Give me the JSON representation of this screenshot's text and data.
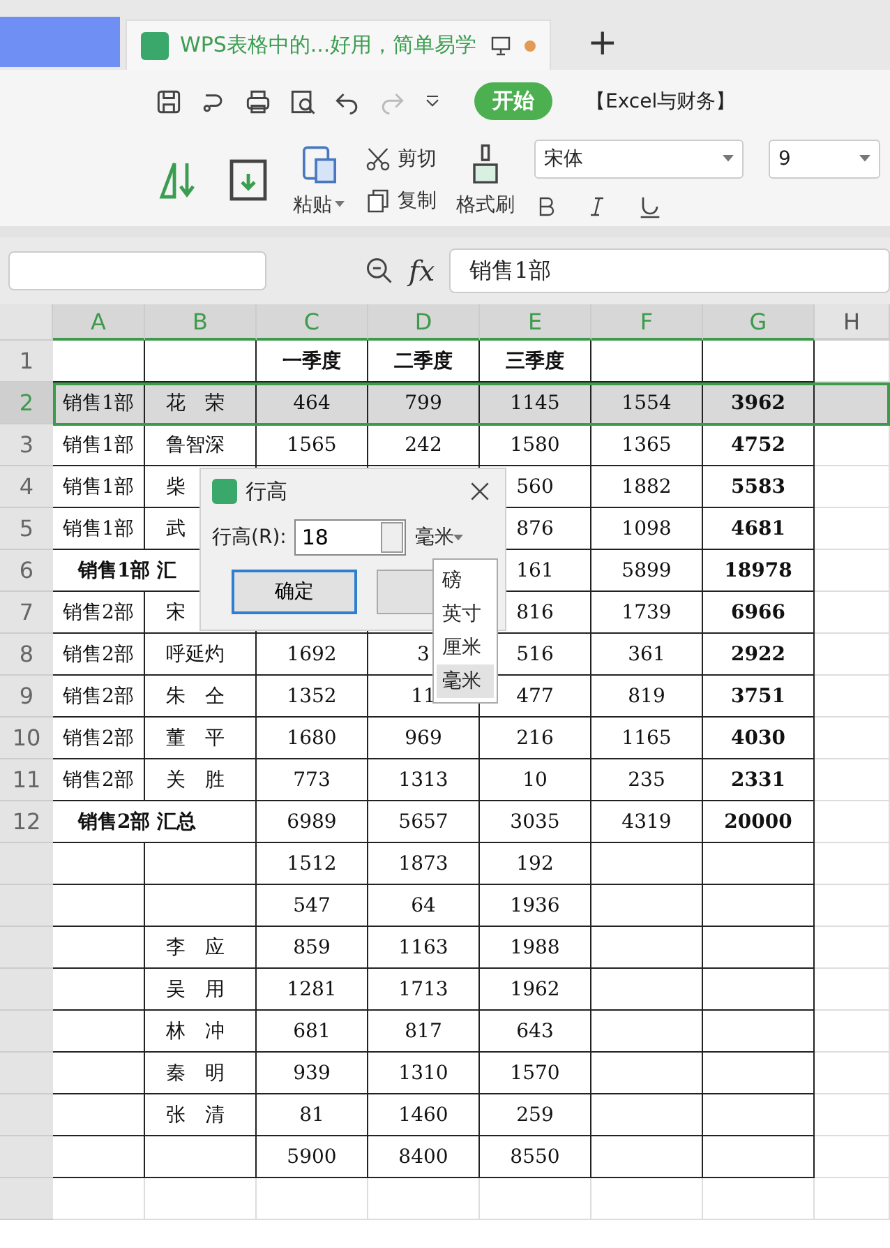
{
  "tab": {
    "title": "WPS表格中的...好用，简单易学",
    "modified": true,
    "new_tab": "+"
  },
  "quick_toolbar": {
    "start_button": "开始",
    "account": "【Excel与财务】"
  },
  "ribbon": {
    "paste": "粘贴",
    "cut": "剪切",
    "copy": "复制",
    "format_painter": "格式刷",
    "font": "宋体",
    "font_size": "9"
  },
  "formula_bar": {
    "fx": "fx",
    "value": "销售1部"
  },
  "columns": [
    {
      "label": "A",
      "highlighted": true
    },
    {
      "label": "B",
      "highlighted": true
    },
    {
      "label": "C",
      "highlighted": true
    },
    {
      "label": "D",
      "highlighted": true
    },
    {
      "label": "E",
      "highlighted": true
    },
    {
      "label": "F",
      "highlighted": true
    },
    {
      "label": "G",
      "highlighted": true
    },
    {
      "label": "H",
      "highlighted": false
    }
  ],
  "rows": [
    {
      "kind": "header",
      "number": "1",
      "selected": false,
      "cells": [
        null,
        null,
        "一季度",
        "二季度",
        "三季度",
        null,
        null
      ]
    },
    {
      "kind": "data",
      "number": "2",
      "selected": true,
      "cells": [
        "销售1部",
        "花　荣",
        "464",
        "799",
        "1145",
        "1554",
        "3962"
      ]
    },
    {
      "kind": "data",
      "number": "3",
      "selected": false,
      "cells": [
        "销售1部",
        "鲁智深",
        "1565",
        "242",
        "1580",
        "1365",
        "4752"
      ]
    },
    {
      "kind": "data",
      "number": "4",
      "selected": false,
      "cells": [
        "销售1部",
        "柴",
        null,
        null,
        "560",
        "1882",
        "5583"
      ]
    },
    {
      "kind": "data",
      "number": "5",
      "selected": false,
      "cells": [
        "销售1部",
        "武",
        null,
        null,
        "876",
        "1098",
        "4681"
      ]
    },
    {
      "kind": "subtotal",
      "number": "6",
      "selected": false,
      "label": "销售1部  汇",
      "cells": [
        null,
        null,
        "161",
        "5899",
        "18978"
      ]
    },
    {
      "kind": "data",
      "number": "7",
      "selected": false,
      "cells": [
        "销售2部",
        "宋",
        null,
        null,
        "816",
        "1739",
        "6966"
      ]
    },
    {
      "kind": "data",
      "number": "8",
      "selected": false,
      "cells": [
        "销售2部",
        "呼延灼",
        "1692",
        "3",
        "516",
        "361",
        "2922"
      ]
    },
    {
      "kind": "data",
      "number": "9",
      "selected": false,
      "cells": [
        "销售2部",
        "朱　仝",
        "1352",
        "11",
        "477",
        "819",
        "3751"
      ]
    },
    {
      "kind": "data",
      "number": "10",
      "selected": false,
      "cells": [
        "销售2部",
        "董　平",
        "1680",
        "969",
        "216",
        "1165",
        "4030"
      ]
    },
    {
      "kind": "data",
      "number": "11",
      "selected": false,
      "cells": [
        "销售2部",
        "关　胜",
        "773",
        "1313",
        "10",
        "235",
        "2331"
      ]
    },
    {
      "kind": "subtotal",
      "number": "12",
      "selected": false,
      "label": "销售2部  汇总",
      "cells": [
        "6989",
        "5657",
        "3035",
        "4319",
        "20000"
      ]
    },
    {
      "kind": "data",
      "selected": false,
      "cells": [
        null,
        null,
        "1512",
        "1873",
        "192",
        null,
        null
      ]
    },
    {
      "kind": "data",
      "selected": false,
      "cells": [
        null,
        null,
        "547",
        "64",
        "1936",
        null,
        null
      ]
    },
    {
      "kind": "data",
      "selected": false,
      "cells": [
        null,
        "李　应",
        "859",
        "1163",
        "1988",
        null,
        null
      ]
    },
    {
      "kind": "data",
      "selected": false,
      "cells": [
        null,
        "吴　用",
        "1281",
        "1713",
        "1962",
        null,
        null
      ]
    },
    {
      "kind": "data",
      "selected": false,
      "cells": [
        null,
        "林　冲",
        "681",
        "817",
        "643",
        null,
        null
      ]
    },
    {
      "kind": "data",
      "selected": false,
      "cells": [
        null,
        "秦　明",
        "939",
        "1310",
        "1570",
        null,
        null
      ]
    },
    {
      "kind": "data",
      "selected": false,
      "cells": [
        null,
        "张　清",
        "81",
        "1460",
        "259",
        null,
        null
      ]
    },
    {
      "kind": "data",
      "selected": false,
      "cells": [
        null,
        null,
        "5900",
        "8400",
        "8550",
        null,
        null
      ]
    },
    {
      "kind": "empty",
      "selected": false,
      "cells": []
    }
  ],
  "dialog": {
    "title": "行高",
    "field_label": "行高(R):",
    "value": "18",
    "unit": "毫米",
    "ok": "确定",
    "units": [
      {
        "label": "磅",
        "selected": false
      },
      {
        "label": "英寸",
        "selected": false
      },
      {
        "label": "厘米",
        "selected": false
      },
      {
        "label": "毫米",
        "selected": true
      }
    ]
  }
}
